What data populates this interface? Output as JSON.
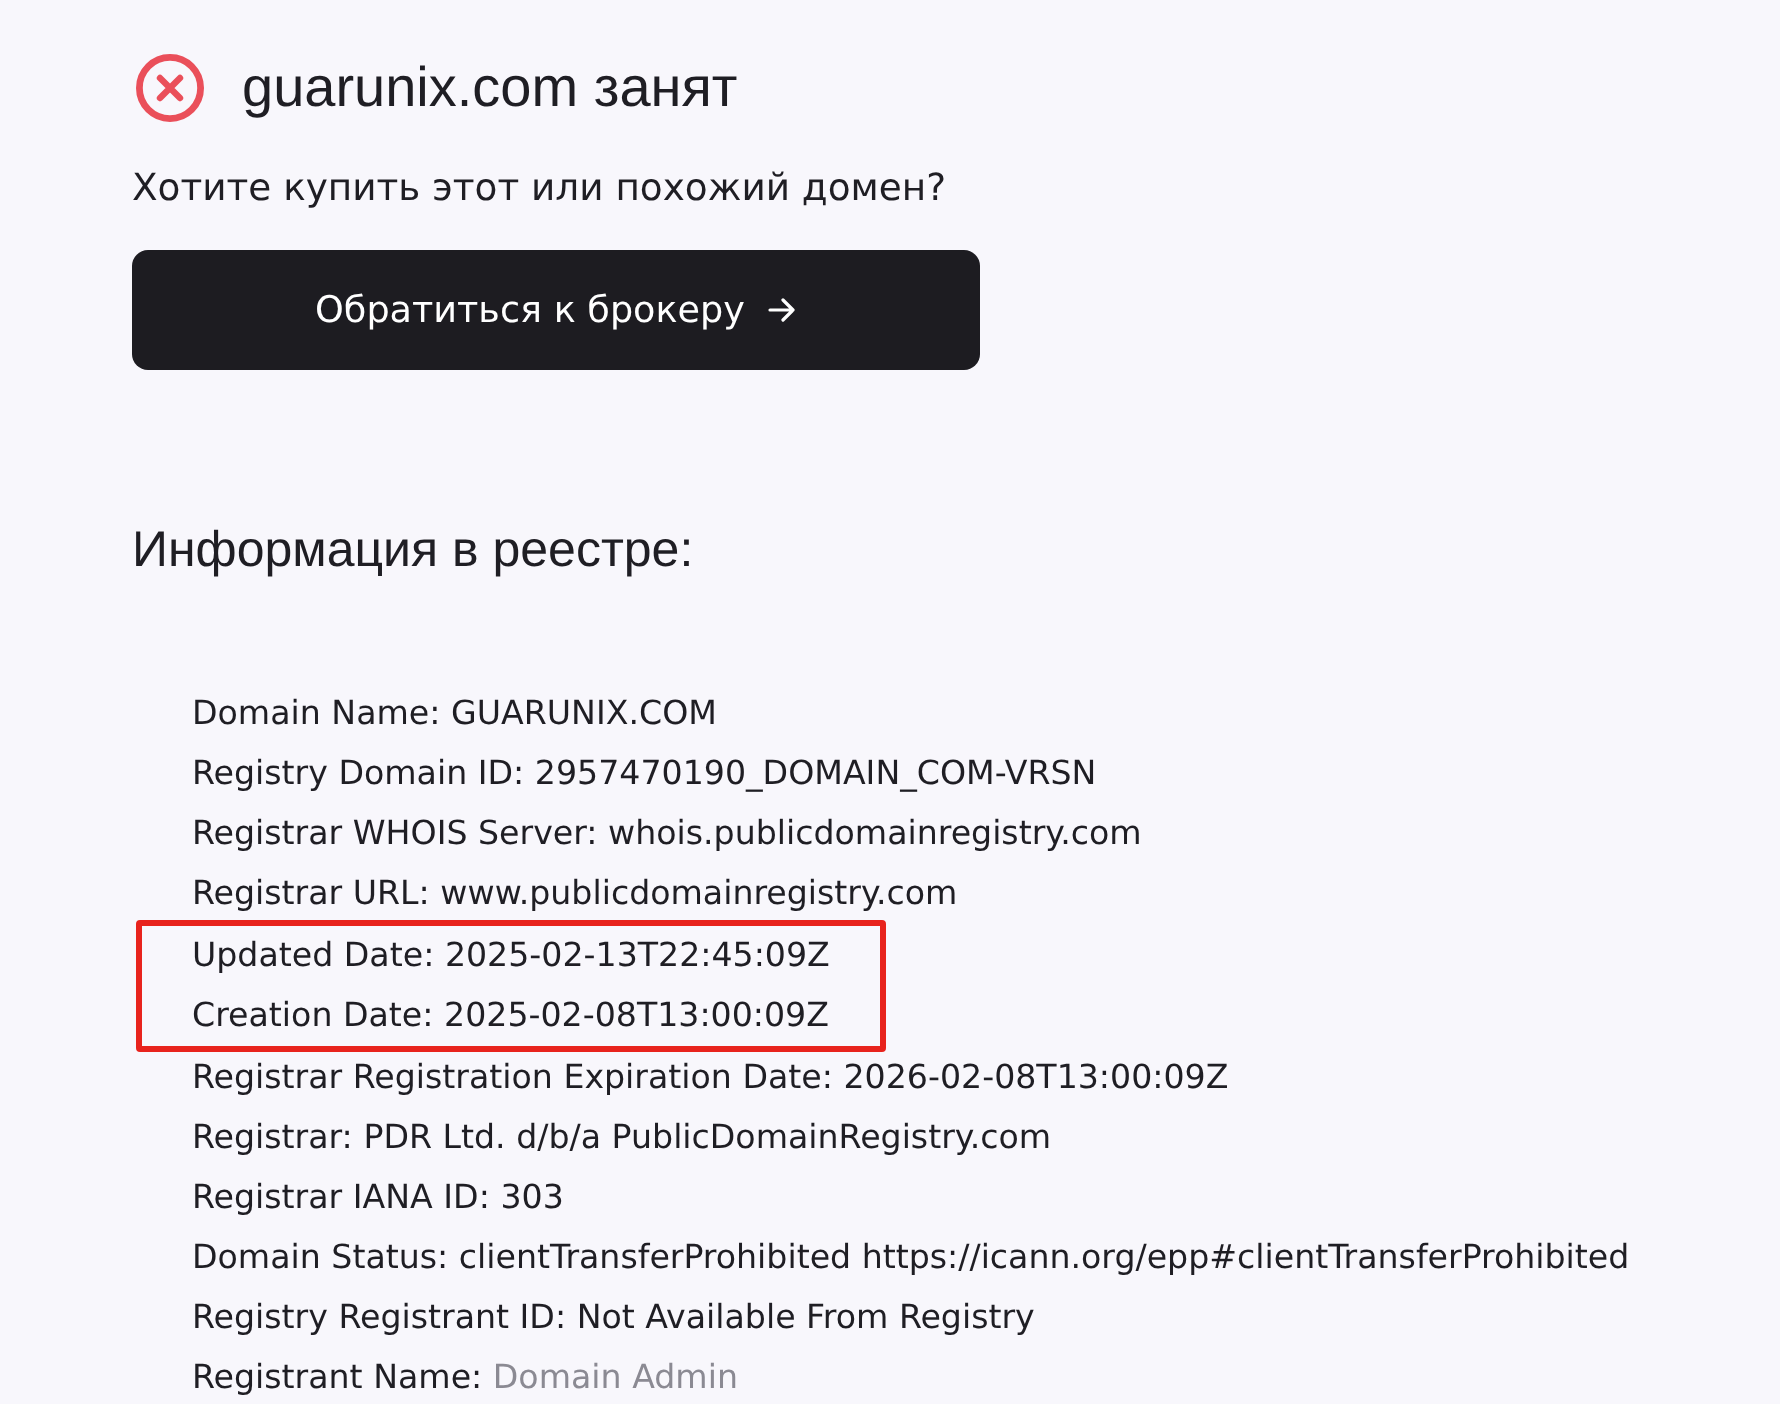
{
  "title": {
    "text": "guarunix.com занят",
    "kind": "taken"
  },
  "prompt": "Хотите купить этот или похожий домен?",
  "broker_button": {
    "label": "Обратиться к брокеру"
  },
  "registry": {
    "heading": "Информация в реестре:",
    "lines": [
      {
        "label": "Domain Name:",
        "value": "GUARUNIX.COM",
        "highlighted": false,
        "faded": false
      },
      {
        "label": "Registry Domain ID:",
        "value": "2957470190_DOMAIN_COM-VRSN",
        "highlighted": false,
        "faded": false
      },
      {
        "label": "Registrar WHOIS Server:",
        "value": "whois.publicdomainregistry.com",
        "highlighted": false,
        "faded": false
      },
      {
        "label": "Registrar URL:",
        "value": "www.publicdomainregistry.com",
        "highlighted": false,
        "faded": false
      },
      {
        "label": "Updated Date:",
        "value": "2025-02-13T22:45:09Z",
        "highlighted": true,
        "faded": false
      },
      {
        "label": "Creation Date:",
        "value": "2025-02-08T13:00:09Z",
        "highlighted": true,
        "faded": false
      },
      {
        "label": "Registrar Registration Expiration Date:",
        "value": "2026-02-08T13:00:09Z",
        "highlighted": false,
        "faded": false
      },
      {
        "label": "Registrar:",
        "value": "PDR Ltd. d/b/a PublicDomainRegistry.com",
        "highlighted": false,
        "faded": false
      },
      {
        "label": "Registrar IANA ID:",
        "value": "303",
        "highlighted": false,
        "faded": false
      },
      {
        "label": "Domain Status:",
        "value": "clientTransferProhibited https://icann.org/epp#clientTransferProhibited",
        "highlighted": false,
        "faded": false
      },
      {
        "label": "Registry Registrant ID:",
        "value": "Not Available From Registry",
        "highlighted": false,
        "faded": false
      },
      {
        "label": "Registrant Name:",
        "value": "Domain Admin",
        "highlighted": false,
        "faded": true
      }
    ]
  }
}
